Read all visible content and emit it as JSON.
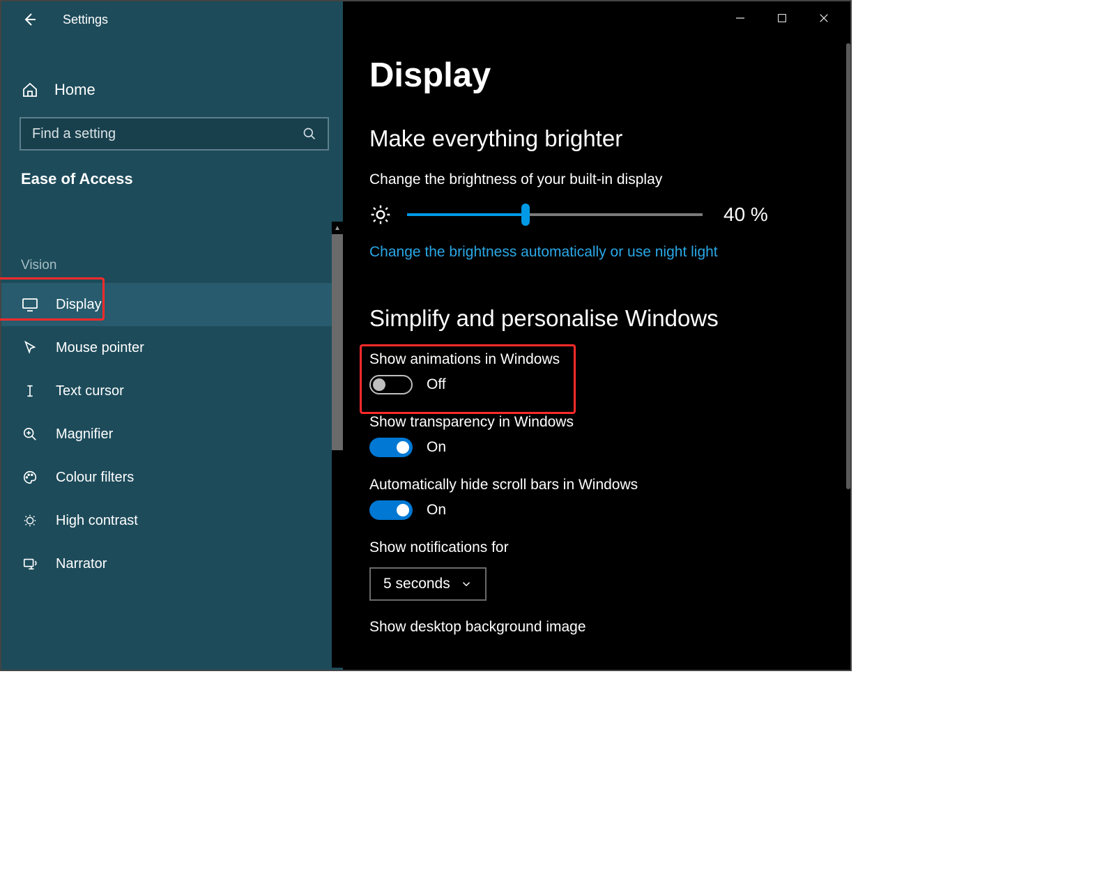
{
  "window": {
    "title": "Settings"
  },
  "sidebar": {
    "home": "Home",
    "search_placeholder": "Find a setting",
    "category": "Ease of Access",
    "group": "Vision",
    "items": [
      {
        "label": "Display",
        "selected": true
      },
      {
        "label": "Mouse pointer"
      },
      {
        "label": "Text cursor"
      },
      {
        "label": "Magnifier"
      },
      {
        "label": "Colour filters"
      },
      {
        "label": "High contrast"
      },
      {
        "label": "Narrator"
      }
    ]
  },
  "main": {
    "title": "Display",
    "brightness": {
      "heading": "Make everything brighter",
      "label": "Change the brightness of your built-in display",
      "value": 40,
      "value_text": "40 %",
      "link": "Change the brightness automatically or use night light"
    },
    "simplify": {
      "heading": "Simplify and personalise Windows",
      "animations": {
        "label": "Show animations in Windows",
        "state": "Off",
        "on": false
      },
      "transparency": {
        "label": "Show transparency in Windows",
        "state": "On",
        "on": true
      },
      "scrollbars": {
        "label": "Automatically hide scroll bars in Windows",
        "state": "On",
        "on": true
      },
      "notifications": {
        "label": "Show notifications for",
        "value": "5 seconds"
      },
      "background": {
        "label": "Show desktop background image"
      }
    }
  }
}
